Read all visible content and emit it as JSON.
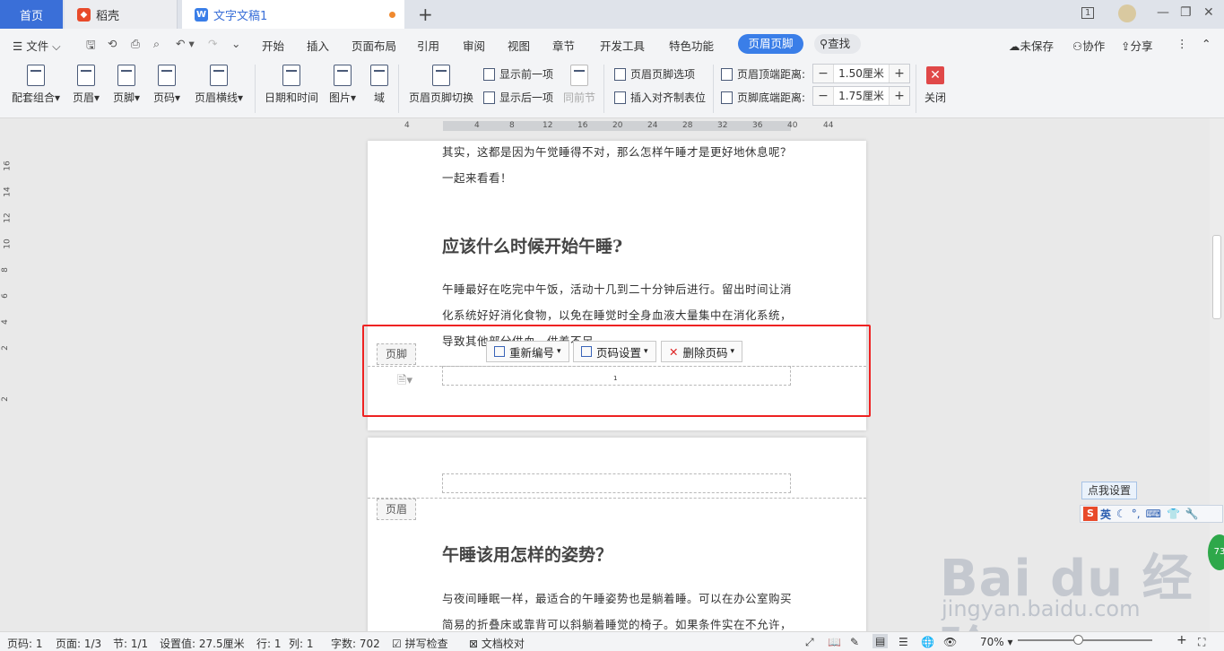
{
  "tabs": {
    "home": "首页",
    "daoke": "稻壳",
    "doc": "文字文稿1",
    "page_badge": "1"
  },
  "menu": {
    "file": "文件",
    "items": [
      "开始",
      "插入",
      "页面布局",
      "引用",
      "审阅",
      "视图",
      "章节",
      "开发工具",
      "特色功能"
    ],
    "active": "页眉页脚",
    "search": "查找",
    "unsaved": "未保存",
    "collab": "协作",
    "share": "分享"
  },
  "ribbon": {
    "combo": "配套组合",
    "header": "页眉",
    "footer": "页脚",
    "page_num": "页码",
    "header_line": "页眉横线",
    "datetime": "日期和时间",
    "picture": "图片",
    "field": "域",
    "hf_switch": "页眉页脚切换",
    "show_prev": "显示前一项",
    "show_next": "显示后一项",
    "same_prev": "同前节",
    "hf_options": "页眉页脚选项",
    "insert_tab": "插入对齐制表位",
    "header_dist_label": "页眉顶端距离:",
    "header_dist_value": "1.50厘米",
    "footer_dist_label": "页脚底端距离:",
    "footer_dist_value": "1.75厘米",
    "close": "关闭"
  },
  "ruler": {
    "h_ticks": [
      "4",
      "4",
      "8",
      "12",
      "16",
      "20",
      "24",
      "28",
      "32",
      "36",
      "40",
      "44"
    ],
    "v_ticks": [
      "16",
      "14",
      "12",
      "10",
      "8",
      "6",
      "4",
      "2",
      "2"
    ]
  },
  "page1": {
    "line1": "其实，这都是因为午觉睡得不对，那么怎样午睡才是更好地休息呢？",
    "line2": "一起来看看！",
    "heading": "应该什么时候开始午睡?",
    "para1": "午睡最好在吃完中午饭，活动十几到二十分钟后进行。留出时间让消",
    "para2": "化系统好好消化食物，以免在睡觉时全身血液大量集中在消化系统，",
    "para3": "导致其他部分供血，供养不足。",
    "footer_tag": "页脚",
    "footer_pagenum": "1"
  },
  "footer_toolbar": {
    "renumber": "重新编号",
    "page_setup": "页码设置",
    "delete": "删除页码"
  },
  "page2": {
    "header_tag": "页眉",
    "heading": "午睡该用怎样的姿势？",
    "para1": "与夜间睡眠一样，最适合的午睡姿势也是躺着睡。可以在办公室购买",
    "para2": "简易的折叠床或靠背可以斜躺着睡觉的椅子。如果条件实在不允许，"
  },
  "ime": {
    "tip": "点我设置",
    "lang": "英"
  },
  "status": {
    "page_num": "页码: 1",
    "pages": "页面: 1/3",
    "section": "节: 1/1",
    "setting": "设置值: 27.5厘米",
    "row": "行: 1",
    "col": "列: 1",
    "words": "字数: 702",
    "spell": "拼写检查",
    "proof": "文档校对",
    "zoom": "70%",
    "zoom_level": 0.45
  },
  "watermark": {
    "brand": "Bai du 经验",
    "url": "jingyan.baidu.com",
    "badge": "73"
  }
}
